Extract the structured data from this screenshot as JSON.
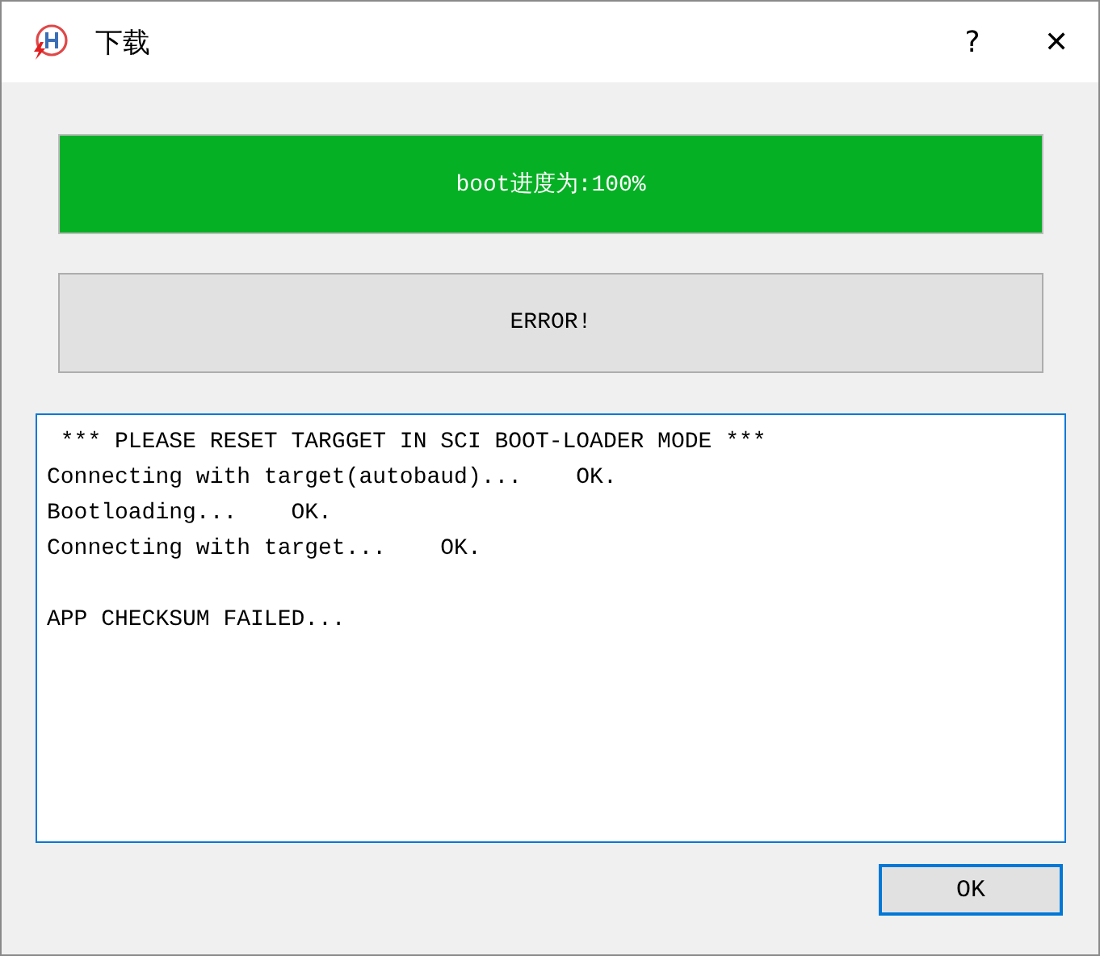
{
  "window": {
    "title": "下载",
    "help": "?",
    "close": "✕"
  },
  "progress": {
    "label": "boot进度为:100%",
    "level": 1
  },
  "status_button": {
    "label": "ERROR!"
  },
  "log": {
    "paragraphs": [
      [
        " *** PLEASE RESET TARGGET IN SCI BOOT-LOADER MODE ***",
        "Connecting with target(autobaud)...    OK.",
        "Bootloading...    OK.",
        "Connecting with target...    OK."
      ],
      [
        "APP CHECKSUM FAILED..."
      ]
    ],
    "focused": true
  },
  "ok_button": {
    "label": "OK",
    "focused": true
  }
}
